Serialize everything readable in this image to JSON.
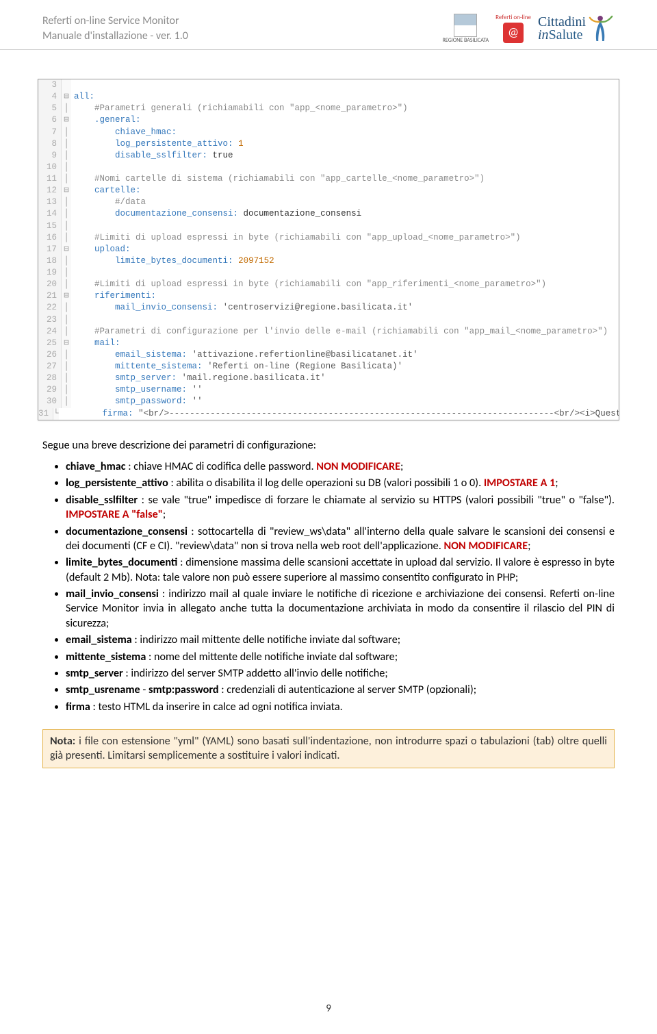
{
  "header": {
    "title1": "Referti on-line Service Monitor",
    "title2": "Manuale d'installazione - ver. 1.0",
    "regione_label": "REGIONE BASILICATA",
    "referti_label": "Referti on-line",
    "cittadini": "Cittadini",
    "in": "in",
    "salute": "Salute"
  },
  "code": {
    "lines": [
      {
        "n": "3",
        "f": " ",
        "t": ""
      },
      {
        "n": "4",
        "f": "⊟",
        "t": "all:",
        "cls": "kw"
      },
      {
        "n": "5",
        "f": "│",
        "t": "    #Parametri generali (richiamabili con \"app_<nome_parametro>\")",
        "cls": "comment"
      },
      {
        "n": "6",
        "f": "⊟",
        "t": "    .general:",
        "cls": "kw"
      },
      {
        "n": "7",
        "f": "│",
        "html": "        <span class='kw'>chiave_hmac:</span> "
      },
      {
        "n": "8",
        "f": "│",
        "html": "        <span class='kw'>log_persistente_attivo:</span> <span class='num'>1</span>"
      },
      {
        "n": "9",
        "f": "│",
        "html": "        <span class='kw'>disable_sslfilter:</span> true"
      },
      {
        "n": "10",
        "f": "│",
        "t": ""
      },
      {
        "n": "11",
        "f": "│",
        "t": "    #Nomi cartelle di sistema (richiamabili con \"app_cartelle_<nome_parametro>\")",
        "cls": "comment"
      },
      {
        "n": "12",
        "f": "⊟",
        "t": "    cartelle:",
        "cls": "kw"
      },
      {
        "n": "13",
        "f": "│",
        "t": "        #/data",
        "cls": "comment"
      },
      {
        "n": "14",
        "f": "│",
        "html": "        <span class='kw'>documentazione_consensi:</span> documentazione_consensi"
      },
      {
        "n": "15",
        "f": "│",
        "t": ""
      },
      {
        "n": "16",
        "f": "│",
        "t": "    #Limiti di upload espressi in byte (richiamabili con \"app_upload_<nome_parametro>\")",
        "cls": "comment"
      },
      {
        "n": "17",
        "f": "⊟",
        "t": "    upload:",
        "cls": "kw"
      },
      {
        "n": "18",
        "f": "│",
        "html": "        <span class='kw'>limite_bytes_documenti:</span> <span class='num'>2097152</span>"
      },
      {
        "n": "19",
        "f": "│",
        "t": ""
      },
      {
        "n": "20",
        "f": "│",
        "t": "    #Limiti di upload espressi in byte (richiamabili con \"app_riferimenti_<nome_parametro>\")",
        "cls": "comment"
      },
      {
        "n": "21",
        "f": "⊟",
        "t": "    riferimenti:",
        "cls": "kw"
      },
      {
        "n": "22",
        "f": "│",
        "html": "        <span class='kw'>mail_invio_consensi:</span> <span class='str'>'centroservizi@regione.basilicata.it'</span>"
      },
      {
        "n": "23",
        "f": "│",
        "t": ""
      },
      {
        "n": "24",
        "f": "│",
        "t": "    #Parametri di configurazione per l'invio delle e-mail (richiamabili con \"app_mail_<nome_parametro>\")",
        "cls": "comment"
      },
      {
        "n": "25",
        "f": "⊟",
        "t": "    mail:",
        "cls": "kw"
      },
      {
        "n": "26",
        "f": "│",
        "html": "        <span class='kw'>email_sistema:</span> <span class='str'>'attivazione.refertionline@basilicatanet.it'</span>"
      },
      {
        "n": "27",
        "f": "│",
        "html": "        <span class='kw'>mittente_sistema:</span> <span class='str'>'Referti on-line (Regione Basilicata)'</span>"
      },
      {
        "n": "28",
        "f": "│",
        "html": "        <span class='kw'>smtp_server:</span> <span class='str'>'mail.regione.basilicata.it'</span>"
      },
      {
        "n": "29",
        "f": "│",
        "html": "        <span class='kw'>smtp_username:</span> <span class='str'>''</span>"
      },
      {
        "n": "30",
        "f": "│",
        "html": "        <span class='kw'>smtp_password:</span> <span class='str'>''</span>"
      },
      {
        "n": "31",
        "f": "└",
        "html": "        <span class='kw'>firma:</span> <span class='str'>\"&lt;br/&gt;---------------------------------------------------------------------------&lt;br/&gt;&lt;i&gt;Questa</span>"
      }
    ]
  },
  "intro": "Segue una breve descrizione dei parametri di configurazione:",
  "bullets": [
    {
      "html": "<span class='bold'>chiave_hmac</span> : chiave HMAC di codifica delle password. <span class='red'>NON MODIFICARE</span>;"
    },
    {
      "html": "<span class='bold'>log_persistente_attivo</span> : abilita o disabilita il log delle operazioni su DB (valori possibili 1 o 0). <span class='red'>IMPOSTARE A 1</span>;"
    },
    {
      "html": "<span class='bold'>disable_sslfilter</span> : se vale \"true\" impedisce di forzare le chiamate al servizio su HTTPS (valori possibili \"true\" o \"false\"). <span class='red'>IMPOSTARE A  \"false\"</span>;"
    },
    {
      "html": "<span class='bold'>documentazione_consensi</span> : sottocartella di \"review_ws\\data\" all'interno della quale salvare le scansioni dei consensi e dei documenti (CF e CI). \"review\\data\" non si trova nella web root dell'applicazione. <span class='red'>NON MODIFICARE</span>;"
    },
    {
      "html": "<span class='bold'>limite_bytes_documenti</span> : dimensione massima delle scansioni accettate in upload dal servizio. Il valore è espresso in byte (default 2 Mb). Nota: tale valore non può essere superiore al massimo consentito configurato in PHP;"
    },
    {
      "html": " <span class='bold'>mail_invio_consensi</span> : indirizzo mail al quale inviare le notifiche di ricezione e archiviazione dei consensi. Referti on-line Service Monitor invia in allegato anche tutta la documentazione archiviata in modo da consentire il rilascio del PIN di sicurezza;"
    },
    {
      "html": "<span class='bold'>email_sistema</span> : indirizzo mail mittente delle notifiche inviate dal software;"
    },
    {
      "html": "<span class='bold'>mittente_sistema</span> : nome del mittente delle notifiche inviate dal software;"
    },
    {
      "html": "<span class='bold'>smtp_server</span> : indirizzo del server SMTP addetto all'invio delle notifiche;"
    },
    {
      "html": "<span class='bold'>smtp_usrename</span> - <span class='bold'>smtp:password</span> : credenziali di autenticazione al server SMTP (opzionali);"
    },
    {
      "html": "<span class='bold'>firma</span> : testo HTML da inserire in calce ad ogni notifica inviata."
    }
  ],
  "note": "Nota: i file con estensione \"yml\" (YAML) sono basati sull'indentazione, non introdurre spazi o tabulazioni (tab) oltre quelli già presenti. Limitarsi semplicemente a sostituire i valori indicati.",
  "page": "9"
}
